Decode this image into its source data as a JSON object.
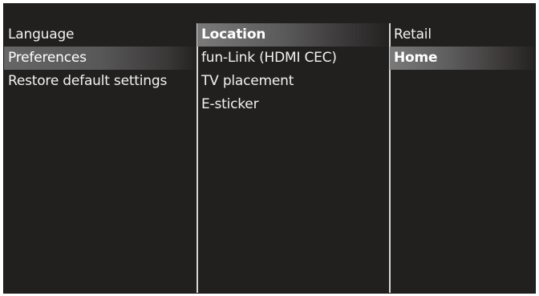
{
  "menu": {
    "column1": [
      {
        "label": "Language",
        "selected": false
      },
      {
        "label": "Preferences",
        "selected": true
      },
      {
        "label": "Restore default settings",
        "selected": false
      }
    ],
    "column2": [
      {
        "label": "Location",
        "selected": true
      },
      {
        "label": "fun-Link (HDMI CEC)",
        "selected": false
      },
      {
        "label": "TV placement",
        "selected": false
      },
      {
        "label": "E-sticker",
        "selected": false
      }
    ],
    "column3": [
      {
        "label": "Retail",
        "selected": false
      },
      {
        "label": "Home",
        "selected": true
      }
    ]
  },
  "colors": {
    "background": "#221f1f",
    "highlight": "#7a7a7a",
    "divider": "#d6d6d6",
    "text": "#ffffff"
  }
}
